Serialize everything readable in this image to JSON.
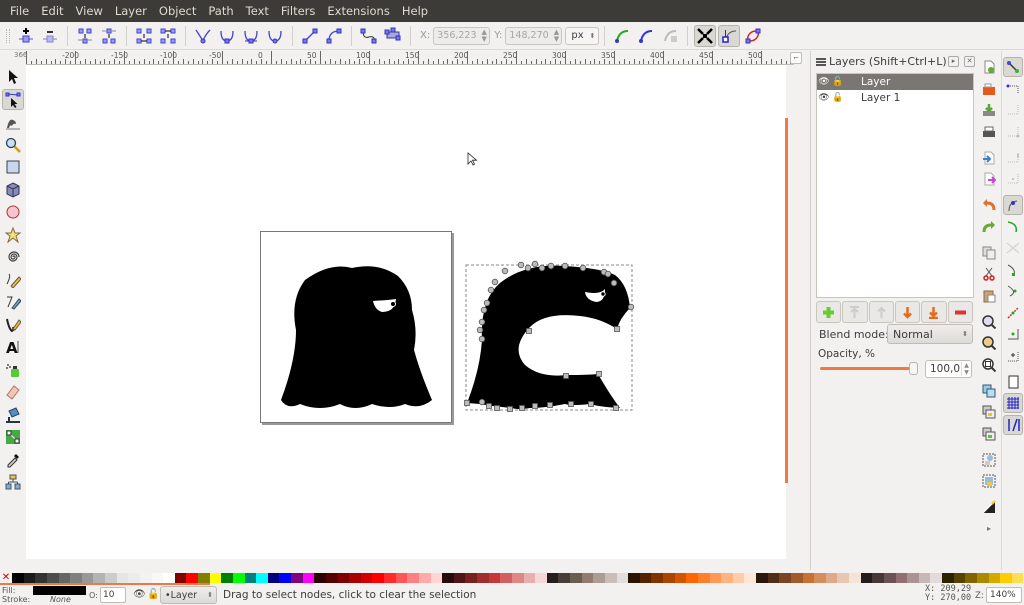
{
  "menu": [
    "File",
    "Edit",
    "View",
    "Layer",
    "Object",
    "Path",
    "Text",
    "Filters",
    "Extensions",
    "Help"
  ],
  "toolbar": {
    "node_buttons": [
      {
        "name": "insert-node",
        "icon": "insert-node-icon"
      },
      {
        "name": "delete-node",
        "icon": "delete-node-icon"
      },
      {
        "name": "join-nodes",
        "icon": "join-nodes-icon"
      },
      {
        "name": "break-path",
        "icon": "break-path-icon"
      },
      {
        "name": "join-segment",
        "icon": "join-segment-icon"
      },
      {
        "name": "delete-segment",
        "icon": "delete-segment-icon"
      },
      {
        "name": "cusp-node",
        "icon": "cusp-node-icon"
      },
      {
        "name": "smooth-node",
        "icon": "smooth-node-icon"
      },
      {
        "name": "symmetric-node",
        "icon": "symmetric-node-icon"
      },
      {
        "name": "auto-smooth-node",
        "icon": "auto-smooth-node-icon"
      },
      {
        "name": "segment-line",
        "icon": "segment-line-icon"
      },
      {
        "name": "segment-curve",
        "icon": "segment-curve-icon"
      },
      {
        "name": "object-to-path",
        "icon": "object-to-path-icon"
      },
      {
        "name": "stroke-to-path",
        "icon": "stroke-to-path-icon"
      }
    ],
    "x_label": "X:",
    "x_value": "356,223",
    "y_label": "Y:",
    "y_value": "148,270",
    "unit": "px",
    "extra_buttons": [
      "next-path-effect",
      "clippath-edit",
      "mask-edit"
    ],
    "show_transform_handles": true,
    "show_handles": true,
    "show_path_outline": false
  },
  "ruler": {
    "corner": "366",
    "labels": [
      "-200",
      "-150",
      "-100",
      "-50",
      "0",
      "50",
      "100",
      "150",
      "200",
      "250",
      "300",
      "350",
      "400",
      "450",
      "500"
    ]
  },
  "tools": [
    {
      "name": "selector",
      "active": false
    },
    {
      "name": "node",
      "active": true
    },
    {
      "name": "tweak",
      "active": false
    },
    {
      "name": "zoom",
      "active": false
    },
    {
      "name": "rectangle",
      "active": false
    },
    {
      "name": "3d-box",
      "active": false
    },
    {
      "name": "ellipse",
      "active": false
    },
    {
      "name": "star",
      "active": false
    },
    {
      "name": "spiral",
      "active": false
    },
    {
      "name": "pencil",
      "active": false
    },
    {
      "name": "pen",
      "active": false
    },
    {
      "name": "calligraphy",
      "active": false
    },
    {
      "name": "text",
      "active": false
    },
    {
      "name": "spray",
      "active": false
    },
    {
      "name": "eraser",
      "active": false
    },
    {
      "name": "paint-bucket",
      "active": false
    },
    {
      "name": "gradient",
      "active": false
    },
    {
      "name": "dropper",
      "active": false
    },
    {
      "name": "connector",
      "active": false
    }
  ],
  "layers_panel": {
    "title": "Layers (Shift+Ctrl+L)",
    "layers": [
      {
        "name": "Layer",
        "selected": true,
        "visible": true,
        "locked": false
      },
      {
        "name": "Layer 1",
        "selected": false,
        "visible": true,
        "locked": false
      }
    ],
    "buttons": [
      "add-layer",
      "raise-layer-to-top",
      "raise-layer",
      "lower-layer",
      "lower-layer-to-bottom",
      "delete-layer"
    ],
    "blend_mode_label": "Blend mode:",
    "blend_mode_value": "Normal",
    "opacity_label": "Opacity, %",
    "opacity_value": "100,0",
    "opacity_fraction": 1.0
  },
  "commands": [
    "new",
    "open",
    "save",
    "print",
    "import",
    "export",
    "undo",
    "redo",
    "copy",
    "cut",
    "paste",
    "zoom-selection",
    "zoom-drawing",
    "zoom-page",
    "duplicate",
    "clone",
    "unlink-clone",
    "group",
    "ungroup",
    "fill-and-stroke"
  ],
  "snap_controls": [
    "snap-enable",
    "snap-bbox",
    "snap-bbox-edge",
    "snap-bbox-corner",
    "snap-bbox-midpoint",
    "snap-bbox-center",
    "snap-nodes",
    "snap-paths",
    "snap-path-intersection",
    "snap-cusp-nodes",
    "snap-smooth-nodes",
    "snap-midpoints",
    "snap-object-center",
    "snap-rotation-center",
    "snap-page-border",
    "snap-grids",
    "snap-guides"
  ],
  "palette": {
    "colors": [
      "#000000",
      "#1a1a1a",
      "#333333",
      "#4d4d4d",
      "#666666",
      "#808080",
      "#999999",
      "#b3b3b3",
      "#cccccc",
      "#e6e6e6",
      "#ececec",
      "#f2f2f2",
      "#f8f8f8",
      "#ffffff",
      "#800000",
      "#ff0000",
      "#808000",
      "#ffff00",
      "#008000",
      "#00ff00",
      "#008080",
      "#00ffff",
      "#000080",
      "#0000ff",
      "#800080",
      "#ff00ff",
      "#2b0000",
      "#550000",
      "#800000",
      "#aa0000",
      "#d40000",
      "#ff0000",
      "#ff2a2a",
      "#ff5555",
      "#ff8080",
      "#ffaaaa",
      "#ffd5d5",
      "#280b0b",
      "#501616",
      "#782121",
      "#a02c2c",
      "#c83737",
      "#d35f5f",
      "#de8787",
      "#e9afaf",
      "#f4d7d7",
      "#241f1c",
      "#483e37",
      "#6c5d53",
      "#917c6f",
      "#ac9d93",
      "#c8beb7",
      "#e3dedb",
      "#2b1100",
      "#552200",
      "#803300",
      "#aa4400",
      "#d45500",
      "#ff6600",
      "#ff7f2a",
      "#ff9955",
      "#ffb380",
      "#ffccaa",
      "#ffe6d5",
      "#28170b",
      "#502d16",
      "#784421",
      "#a05a2c",
      "#c87137",
      "#d38d5f",
      "#deaa87",
      "#e9c6af",
      "#f4e3d7",
      "#241c1c",
      "#483737",
      "#6c5353",
      "#916f6f",
      "#ac9393",
      "#c8b7b7",
      "#e3dbdb",
      "#2b2200",
      "#554400",
      "#806600",
      "#aa8800",
      "#d4aa00",
      "#ffcc00",
      "#ffdd55"
    ]
  },
  "status": {
    "fill_label": "Fill:",
    "stroke_label": "Stroke:",
    "fill_color": "#000000",
    "stroke_value": "None",
    "opacity_label": "O:",
    "opacity_value": "10",
    "current_layer": "•Layer",
    "message": "Drag to select nodes, click to clear the selection",
    "cursor_x": "X: 209,29",
    "cursor_y": "Y: 270,00",
    "zoom_label": "Z:",
    "zoom_value": "140%"
  }
}
